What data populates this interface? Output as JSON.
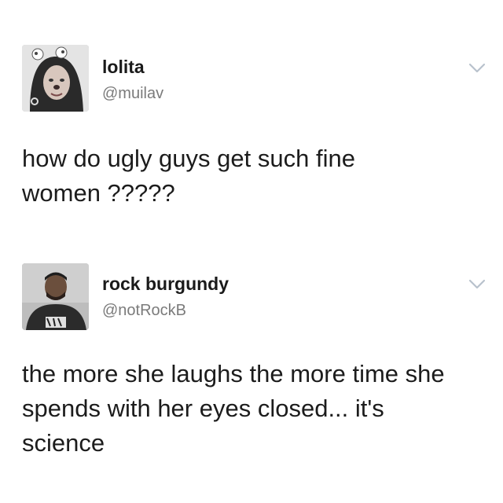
{
  "tweets": [
    {
      "display_name": "lolita",
      "handle": "@muilav",
      "avatar_icon": "profile-photo-woman",
      "lines": [
        "how do ugly guys get such fine",
        "women ?????"
      ]
    },
    {
      "display_name": "rock burgundy",
      "handle": "@notRockB",
      "avatar_icon": "profile-photo-man",
      "lines": [
        "the more she laughs the more time she",
        "spends with her eyes closed...  it's",
        "science"
      ]
    }
  ],
  "colors": {
    "background": "#ffffff",
    "name_text": "#1a1a1a",
    "handle_text": "#7b7b7b",
    "chevron": "#b8c2cc"
  }
}
